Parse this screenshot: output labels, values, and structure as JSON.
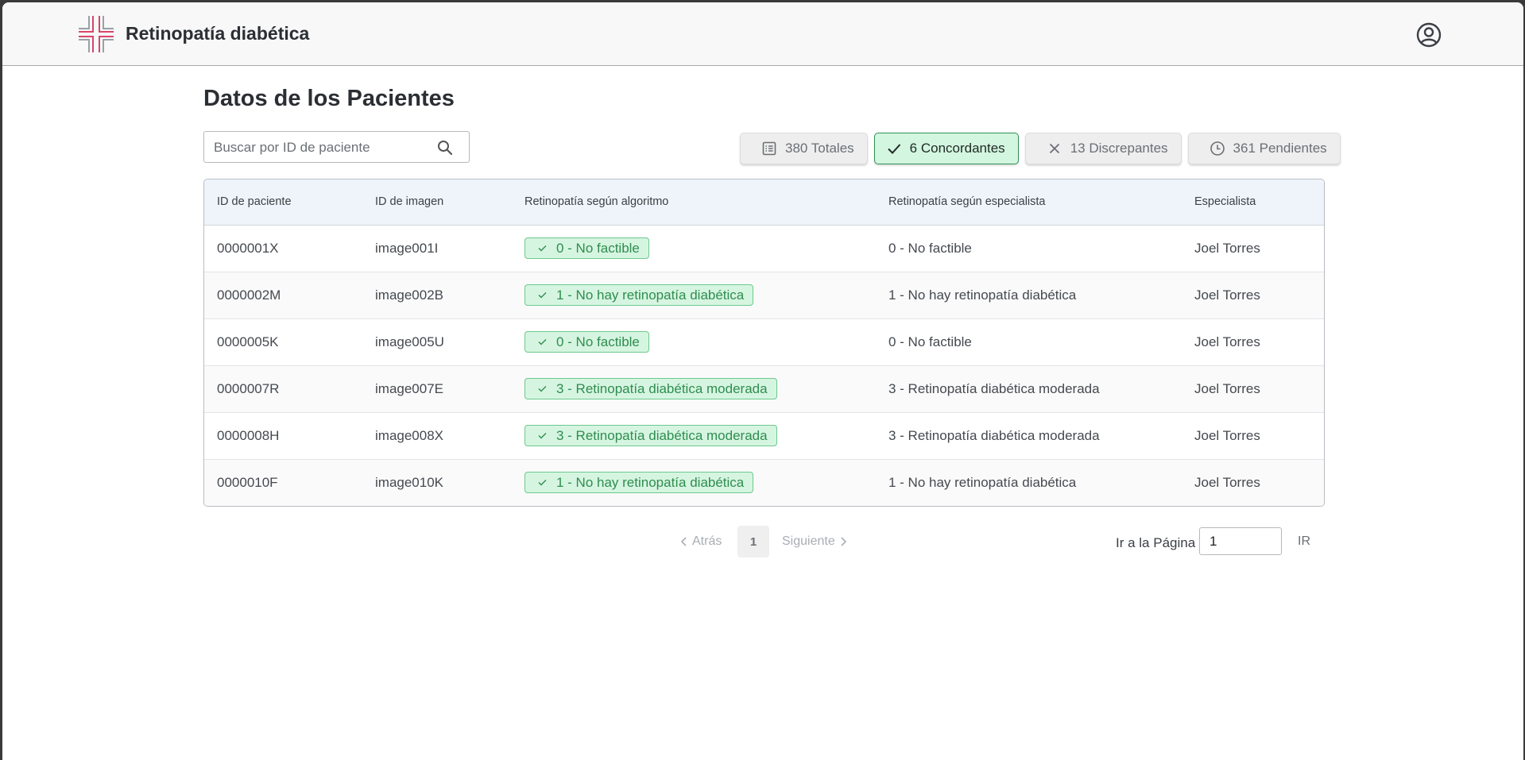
{
  "header": {
    "app_title": "Retinopatía diabética",
    "logo_icon": "retina-cross-logo",
    "user_icon": "user-circle-icon"
  },
  "page": {
    "title": "Datos de los Pacientes"
  },
  "search": {
    "placeholder": "Buscar por ID de paciente",
    "value": ""
  },
  "filters": [
    {
      "label": "380 Totales",
      "icon": "list-icon",
      "active": false
    },
    {
      "label": "6 Concordantes",
      "icon": "check-icon",
      "active": true
    },
    {
      "label": "13 Discrepantes",
      "icon": "x-icon",
      "active": false
    },
    {
      "label": "361 Pendientes",
      "icon": "clock-icon",
      "active": false
    }
  ],
  "table": {
    "columns": [
      "ID de paciente",
      "ID de imagen",
      "Retinopatía según algoritmo",
      "Retinopatía según especialista",
      "Especialista"
    ],
    "rows": [
      {
        "patient_id": "0000001X",
        "image_id": "image001I",
        "algorithm": "0 - No factible",
        "specialist_result": "0 - No factible",
        "specialist": "Joel Torres"
      },
      {
        "patient_id": "0000002M",
        "image_id": "image002B",
        "algorithm": "1 - No hay retinopatía diabética",
        "specialist_result": "1 - No hay retinopatía diabética",
        "specialist": "Joel Torres"
      },
      {
        "patient_id": "0000005K",
        "image_id": "image005U",
        "algorithm": "0 - No factible",
        "specialist_result": "0 - No factible",
        "specialist": "Joel Torres"
      },
      {
        "patient_id": "0000007R",
        "image_id": "image007E",
        "algorithm": "3 - Retinopatía diabética moderada",
        "specialist_result": "3 - Retinopatía diabética moderada",
        "specialist": "Joel Torres"
      },
      {
        "patient_id": "0000008H",
        "image_id": "image008X",
        "algorithm": "3 - Retinopatía diabética moderada",
        "specialist_result": "3 - Retinopatía diabética moderada",
        "specialist": "Joel Torres"
      },
      {
        "patient_id": "0000010F",
        "image_id": "image010K",
        "algorithm": "1 - No hay retinopatía diabética",
        "specialist_result": "1 - No hay retinopatía diabética",
        "specialist": "Joel Torres"
      }
    ]
  },
  "pagination": {
    "prev_label": "Atrás",
    "next_label": "Siguiente",
    "current_page": "1",
    "goto_label": "Ir a la Página",
    "goto_value": "1",
    "goto_button": "IR"
  },
  "colors": {
    "concordant_bg": "#d6f5e1",
    "concordant_text": "#2f8d4f",
    "header_bg": "#eff4fb",
    "logo_red": "#d8466a"
  }
}
